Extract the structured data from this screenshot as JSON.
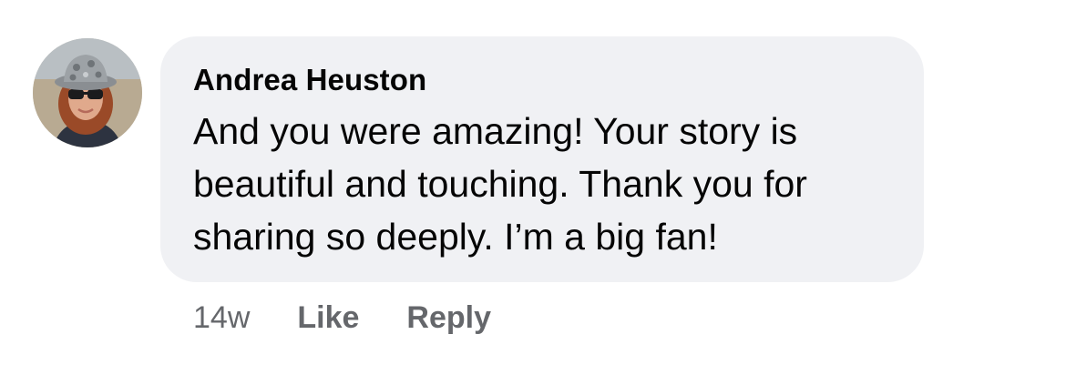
{
  "comment": {
    "author": "Andrea Heuston",
    "text_lines": [
      "And you were amazing! Your story is",
      "beautiful and touching. Thank you for",
      "sharing so deeply. I’m a big fan!"
    ],
    "timestamp": "14w",
    "like_label": "Like",
    "reply_label": "Reply"
  },
  "avatar": {
    "icon": "profile-photo"
  },
  "colors": {
    "bubble_background": "#f0f1f4",
    "text_primary": "#050505",
    "text_secondary": "#65676b"
  }
}
